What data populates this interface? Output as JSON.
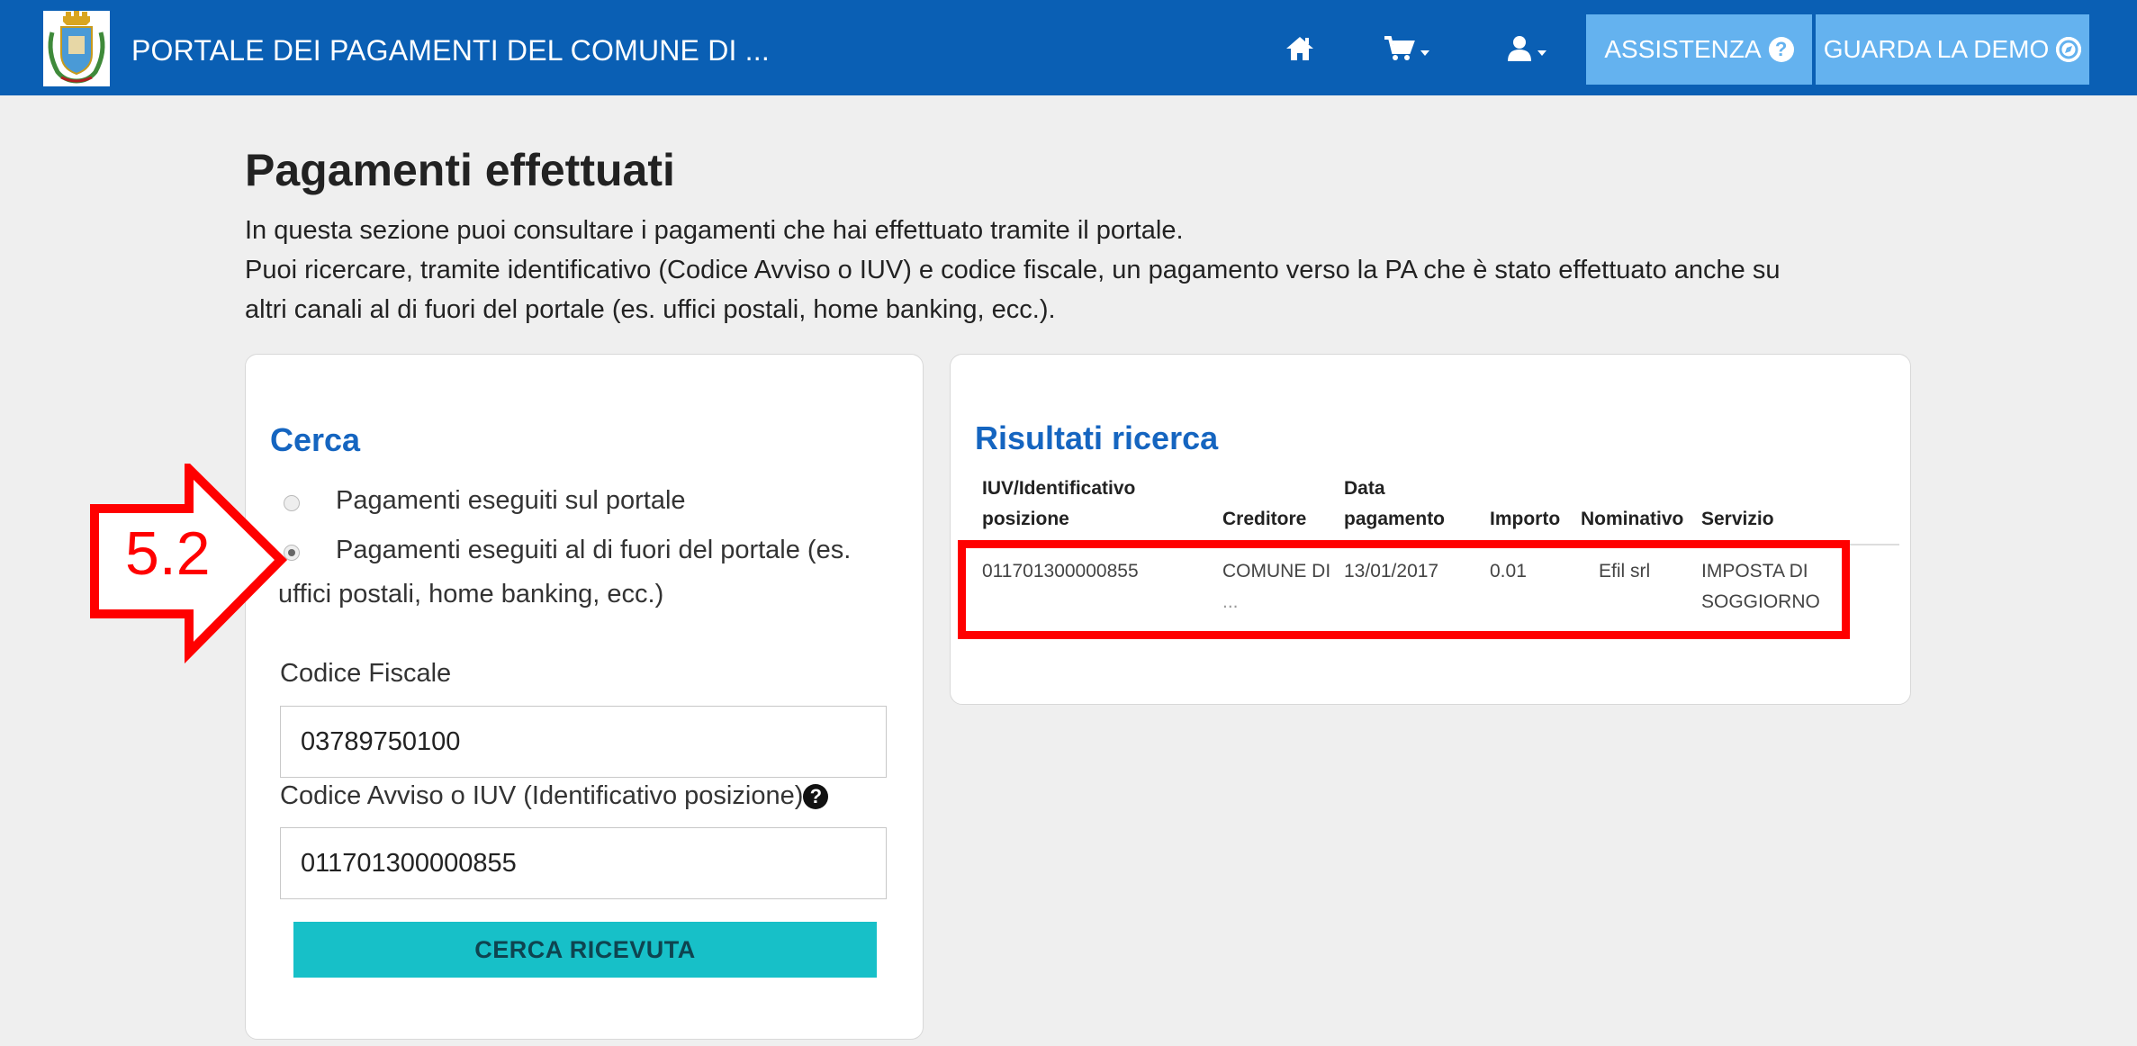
{
  "navbar": {
    "title": "PORTALE DEI PAGAMENTI DEL COMUNE DI ...",
    "icons": [
      "home-icon",
      "cart-icon",
      "user-icon"
    ],
    "assistenza_label": "ASSISTENZA",
    "demo_label": "GUARDA LA DEMO",
    "accent": "#0a5fb4",
    "button_color": "#64b2ef"
  },
  "page": {
    "title": "Pagamenti effettuati",
    "intro_line1": "In questa sezione puoi consultare i pagamenti che hai effettuato tramite il portale.",
    "intro_line2": "Puoi ricercare, tramite identificativo (Codice Avviso o IUV) e codice fiscale, un pagamento verso la PA che è stato effettuato anche su",
    "intro_line3": "altri canali al di fuori del portale (es. uffici postali, home banking, ecc.)."
  },
  "search": {
    "heading": "Cerca",
    "option_portal": "Pagamenti eseguiti sul portale",
    "option_external_1": "Pagamenti eseguiti al di fuori del portale (es.",
    "option_external_2": "uffici postali, home banking, ecc.)",
    "selected_option": "external",
    "codice_fiscale_label": "Codice Fiscale",
    "codice_fiscale_value": "03789750100",
    "iuv_label": "Codice Avviso o IUV (Identificativo posizione)",
    "iuv_value": "011701300000855",
    "submit_label": "CERCA RICEVUTA"
  },
  "results": {
    "heading": "Risultati ricerca",
    "columns": {
      "iuv_1": "IUV/Identificativo",
      "iuv_2": "posizione",
      "creditore": "Creditore",
      "data_1": "Data",
      "data_2": "pagamento",
      "importo": "Importo",
      "nominativo": "Nominativo",
      "servizio": "Servizio"
    },
    "rows": [
      {
        "iuv": "011701300000855",
        "creditore_1": "COMUNE DI",
        "creditore_2": "...",
        "data": "13/01/2017",
        "importo": "0.01",
        "nominativo": "Efil srl",
        "servizio_1": "IMPOSTA DI",
        "servizio_2": "SOGGIORNO"
      }
    ]
  },
  "annotation": {
    "callout_label": "5.2",
    "color": "#ff0000"
  }
}
